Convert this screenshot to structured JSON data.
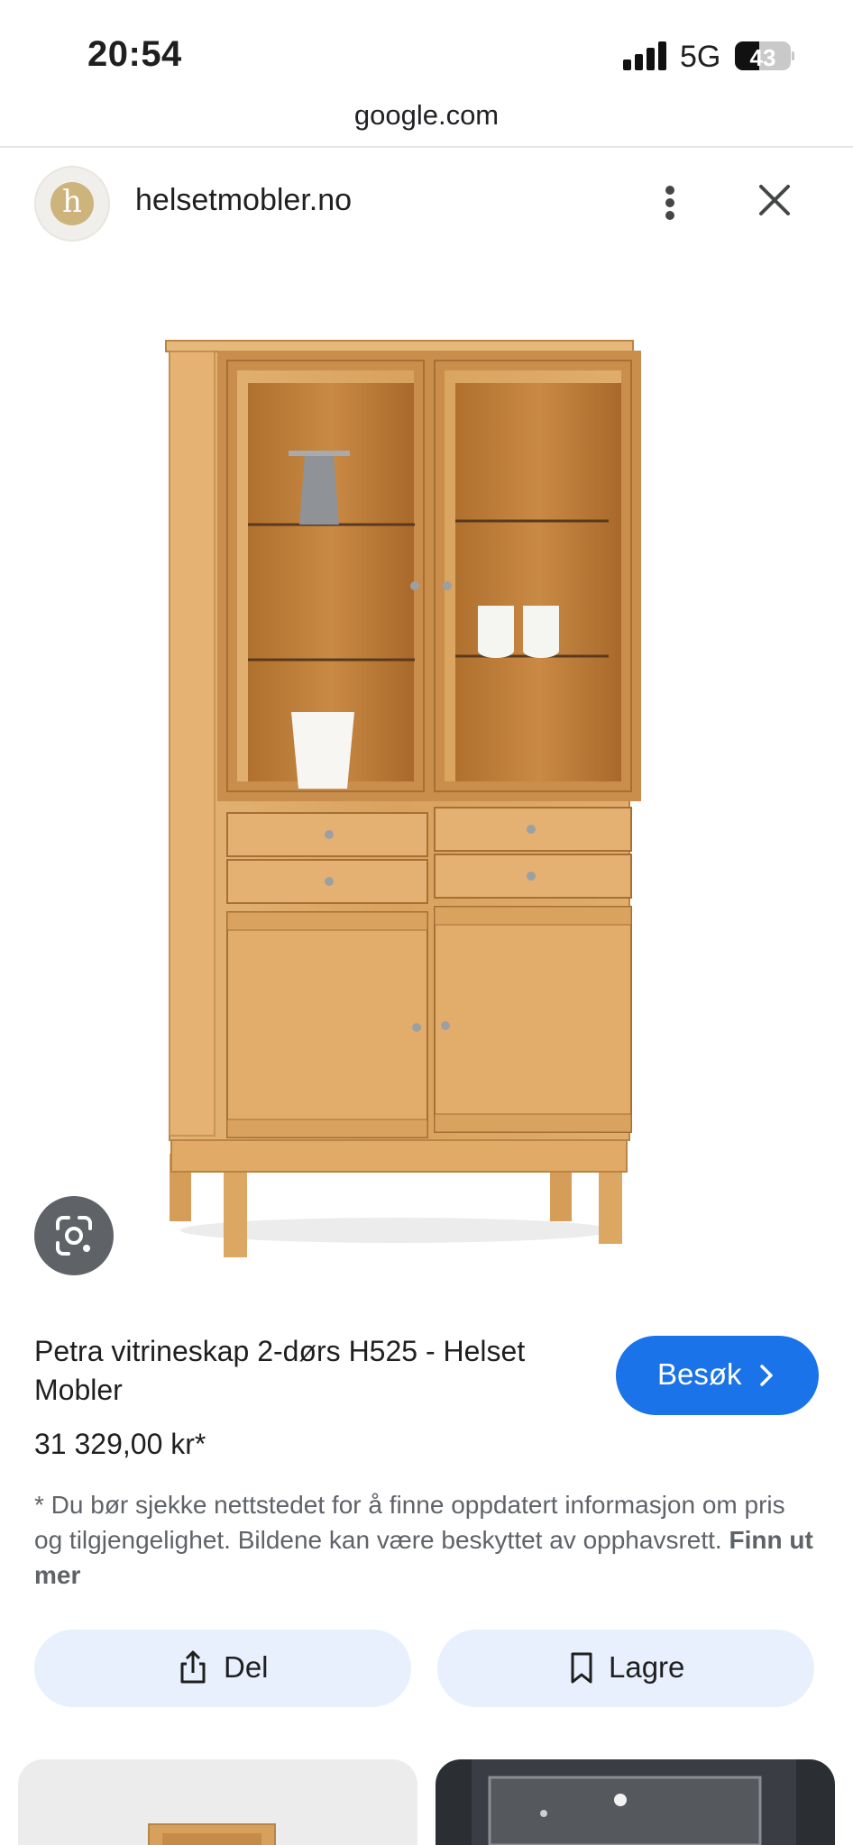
{
  "status_bar": {
    "time": "20:54",
    "network": "5G",
    "battery": "43",
    "battery_level": 0.43
  },
  "browser": {
    "url": "google.com"
  },
  "site": {
    "avatar_letter": "h",
    "name": "helsetmobler.no"
  },
  "product": {
    "title": "Petra vitrineskap 2-dørs H525 - Helset Mobler",
    "price": "31 329,00 kr*",
    "visit_label": "Besøk",
    "disclaimer": "* Du bør sjekke nettstedet for å finne oppdatert informasjon om pris og tilgjengelighet. Bildene kan være beskyttet av opphavsrett.",
    "learn_more": "Finn ut mer"
  },
  "actions": {
    "share_label": "Del",
    "save_label": "Lagre"
  },
  "colors": {
    "accent": "#1a73e8",
    "action_bg": "#e8f0fe",
    "wood": "#d9a25e"
  },
  "icons": [
    "signal-icon",
    "battery-icon",
    "more-vert-icon",
    "close-icon",
    "lens-icon",
    "chevron-right-icon",
    "share-icon",
    "bookmark-icon"
  ]
}
